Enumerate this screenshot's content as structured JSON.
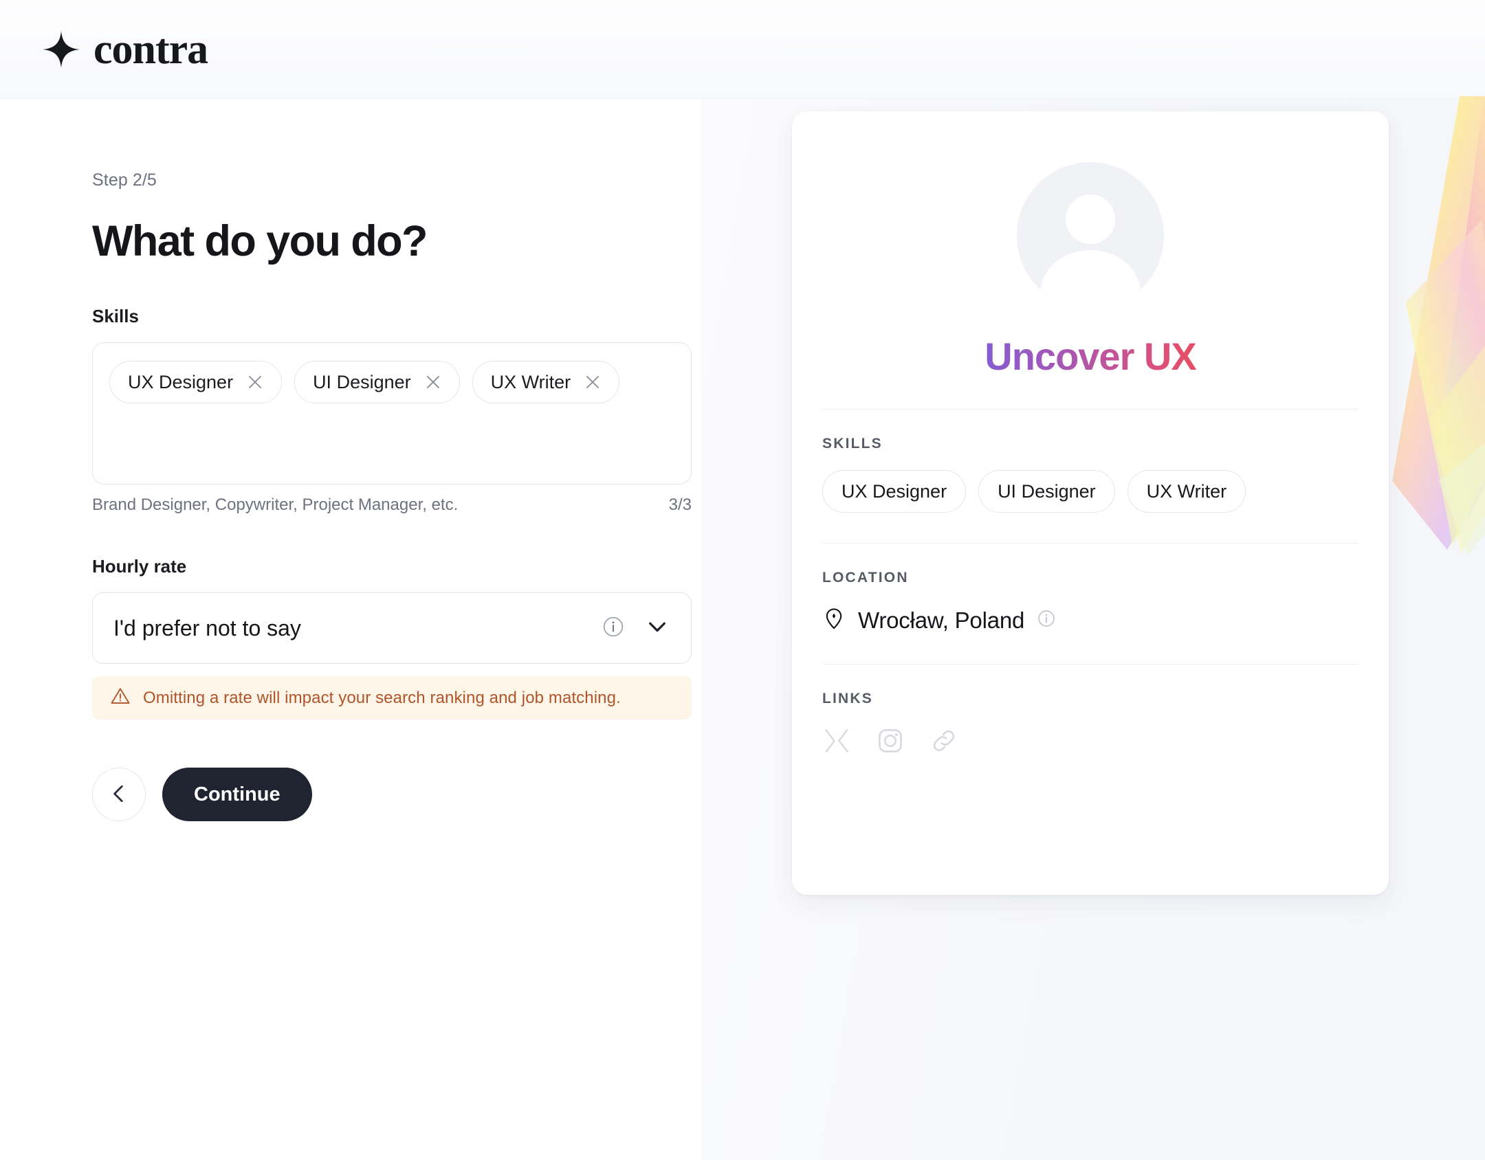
{
  "header": {
    "brand": "contra",
    "logo_icon": "contra-star-icon"
  },
  "form": {
    "step": "Step 2/5",
    "headline": "What do you do?",
    "skills_label": "Skills",
    "skills": [
      {
        "label": "UX Designer",
        "remove_icon": "close-icon"
      },
      {
        "label": "UI Designer",
        "remove_icon": "close-icon"
      },
      {
        "label": "UX Writer",
        "remove_icon": "close-icon"
      }
    ],
    "skills_helper": "Brand Designer, Copywriter, Project Manager, etc.",
    "skills_count": "3/3",
    "rate_label": "Hourly rate",
    "rate_value": "I'd prefer not to say",
    "rate_info_icon": "info-icon",
    "rate_chevron_icon": "chevron-down-icon",
    "warning_icon": "warning-triangle-icon",
    "warning_text": "Omitting a rate will impact your search ranking and job matching.",
    "back_icon": "chevron-left-icon",
    "continue_label": "Continue"
  },
  "preview": {
    "avatar_icon": "avatar-placeholder-icon",
    "title": "Uncover UX",
    "skills_label": "SKILLS",
    "skills": [
      "UX Designer",
      "UI Designer",
      "UX Writer"
    ],
    "location_label": "LOCATION",
    "location_icon": "map-pin-icon",
    "location": "Wrocław, Poland",
    "location_info_icon": "info-icon",
    "links_label": "LINKS",
    "links": [
      {
        "icon": "x-twitter-icon"
      },
      {
        "icon": "instagram-icon"
      },
      {
        "icon": "link-chain-icon"
      }
    ]
  },
  "colors": {
    "accent_dark": "#1f2430",
    "warning_text": "#b1542b",
    "warning_bg": "#fdf6e8",
    "gradient_start": "#5d5fe3",
    "gradient_end": "#fb6a3a"
  }
}
